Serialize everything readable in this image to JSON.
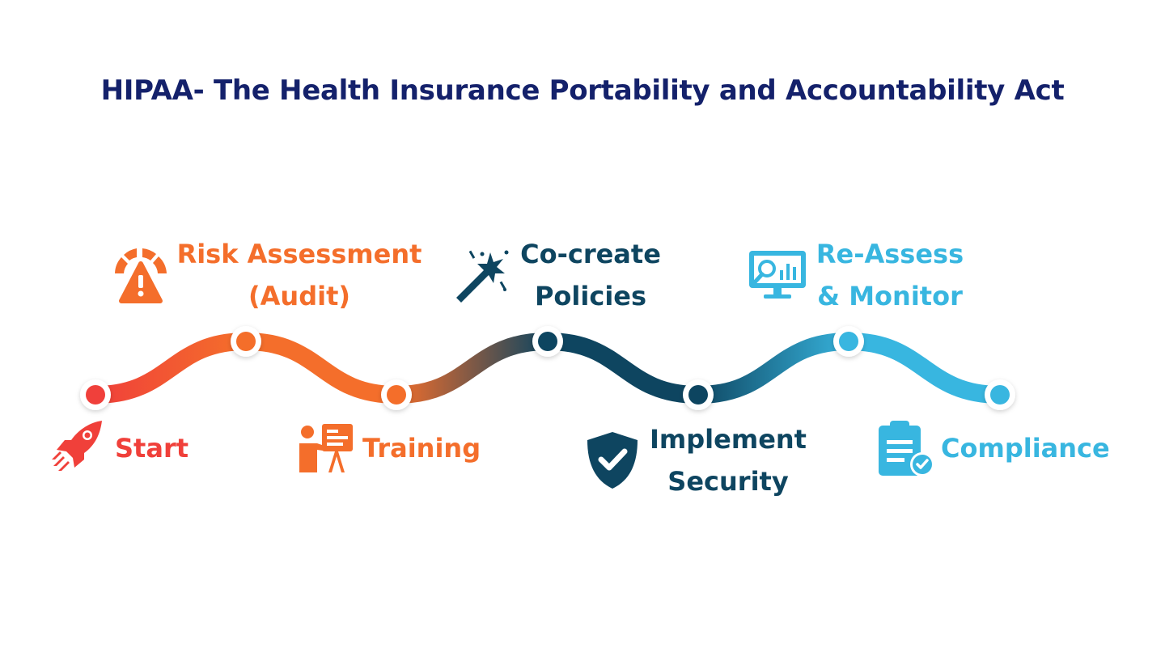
{
  "title": "HIPAA- The Health Insurance Portability and Accountability Act",
  "colors": {
    "title": "#14216b",
    "red": "#f0403a",
    "orange": "#f46e2b",
    "navy": "#0e4560",
    "cyan": "#38b6e0"
  },
  "steps": [
    {
      "id": "start",
      "lines": [
        "Start"
      ],
      "icon": "rocket-icon",
      "color": "#f0403a"
    },
    {
      "id": "risk",
      "lines": [
        "Risk Assessment",
        "(Audit)"
      ],
      "icon": "alert-gauge-icon",
      "color": "#f46e2b"
    },
    {
      "id": "training",
      "lines": [
        "Training"
      ],
      "icon": "presentation-icon",
      "color": "#f46e2b"
    },
    {
      "id": "policies",
      "lines": [
        "Co-create",
        "Policies"
      ],
      "icon": "magic-wand-icon",
      "color": "#0e4560"
    },
    {
      "id": "security",
      "lines": [
        "Implement",
        "Security"
      ],
      "icon": "shield-check-icon",
      "color": "#0e4560"
    },
    {
      "id": "monitor",
      "lines": [
        "Re-Assess",
        "& Monitor"
      ],
      "icon": "monitor-analytics-icon",
      "color": "#38b6e0"
    },
    {
      "id": "compliance",
      "lines": [
        "Compliance"
      ],
      "icon": "clipboard-check-icon",
      "color": "#38b6e0"
    }
  ]
}
